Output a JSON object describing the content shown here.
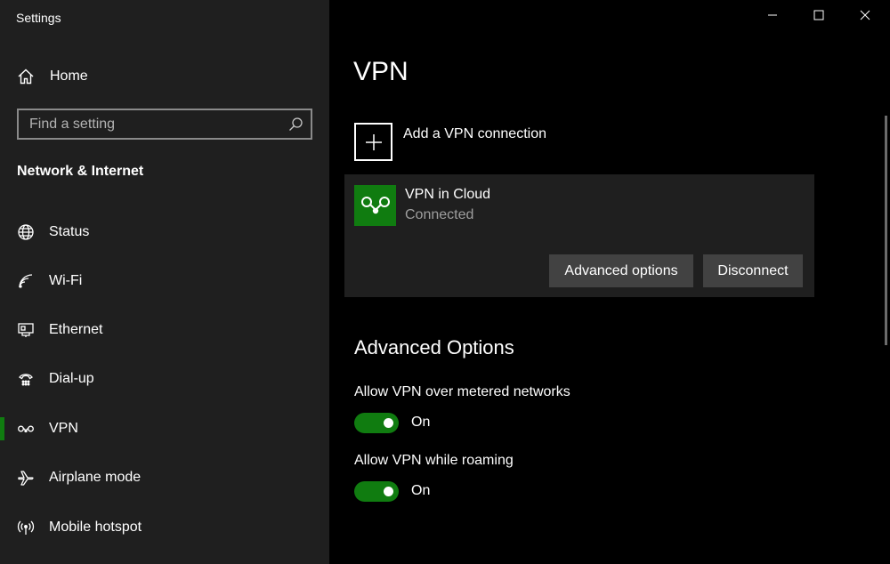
{
  "window": {
    "title": "Settings",
    "controls": {
      "minimize": "minimize-icon",
      "maximize": "maximize-icon",
      "close": "close-icon"
    }
  },
  "sidebar": {
    "home_label": "Home",
    "search_placeholder": "Find a setting",
    "section_title": "Network & Internet",
    "items": [
      {
        "label": "Status",
        "icon": "globe-icon",
        "active": false
      },
      {
        "label": "Wi-Fi",
        "icon": "wifi-icon",
        "active": false
      },
      {
        "label": "Ethernet",
        "icon": "ethernet-icon",
        "active": false
      },
      {
        "label": "Dial-up",
        "icon": "dialup-icon",
        "active": false
      },
      {
        "label": "VPN",
        "icon": "vpn-icon",
        "active": true
      },
      {
        "label": "Airplane mode",
        "icon": "airplane-icon",
        "active": false
      },
      {
        "label": "Mobile hotspot",
        "icon": "hotspot-icon",
        "active": false
      }
    ]
  },
  "main": {
    "title": "VPN",
    "add_vpn_label": "Add a VPN connection",
    "connection": {
      "name": "VPN in Cloud",
      "status": "Connected",
      "advanced_label": "Advanced options",
      "disconnect_label": "Disconnect"
    },
    "advanced": {
      "title": "Advanced Options",
      "options": [
        {
          "label": "Allow VPN over metered networks",
          "state": "On"
        },
        {
          "label": "Allow VPN while roaming",
          "state": "On"
        }
      ]
    }
  },
  "colors": {
    "accent": "#107c10",
    "sidebar_bg": "#1f1f1f",
    "main_bg": "#000000",
    "button_bg": "#424242",
    "secondary_text": "#9e9e9e"
  }
}
